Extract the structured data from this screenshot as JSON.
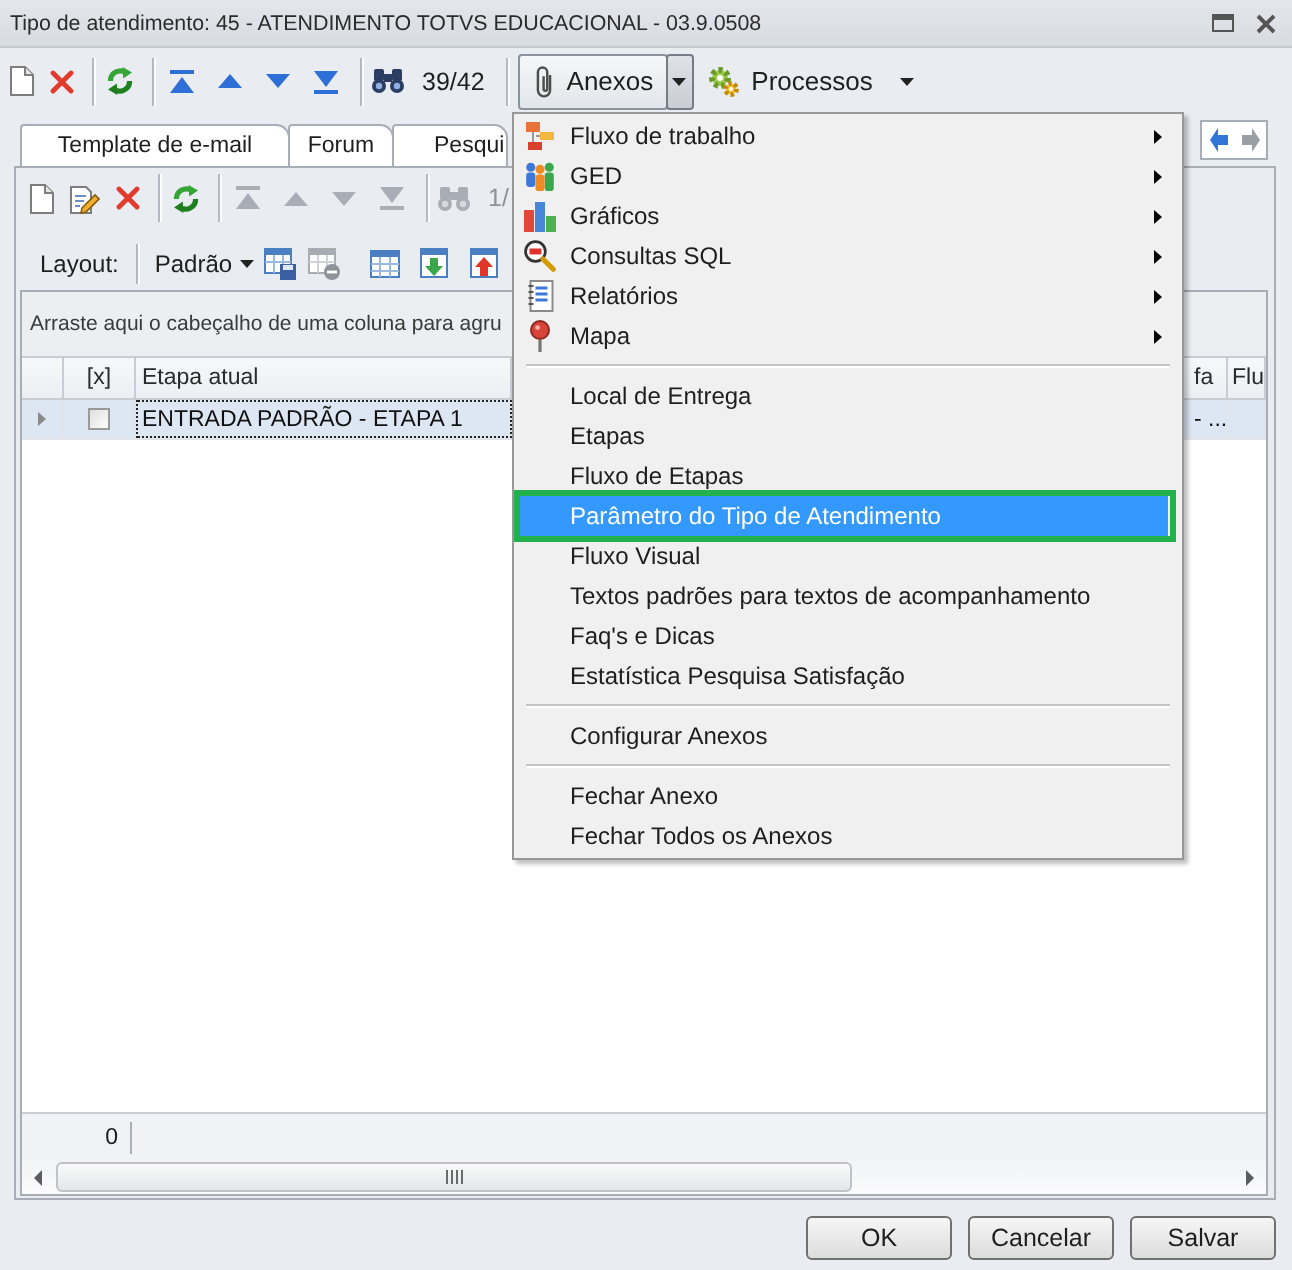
{
  "window": {
    "title": "Tipo de atendimento: 45 - ATENDIMENTO TOTVS EDUCACIONAL - 03.9.0508"
  },
  "toolbar": {
    "navigation_enabled": true,
    "search_enabled": true,
    "record_counter": "39/42",
    "attachments": {
      "label": "Anexos",
      "expanded": true
    },
    "processes": {
      "label": "Processos"
    }
  },
  "tabs": [
    {
      "label": "Template de e-mail"
    },
    {
      "label": "Forum"
    },
    {
      "label": "Pesqui"
    }
  ],
  "grid_toolbar": {
    "navigation_enabled": false,
    "search_enabled": false,
    "record_counter": "1/"
  },
  "layout_bar": {
    "label": "Layout:",
    "layout": "Padrão",
    "remove_enabled": false
  },
  "grid": {
    "group_panel": "Arraste aqui o cabeçalho de uma coluna para agru",
    "checkbox_column": "[x]",
    "columns": [
      "Etapa atual",
      "fa",
      "Flu"
    ],
    "rows": [
      {
        "selected": true,
        "checked": false,
        "cells": [
          "ENTRADA PADRÃO - ETAPA 1",
          "- ..."
        ]
      }
    ],
    "footer": "0"
  },
  "anexos_menu": {
    "sections": [
      {
        "items": [
          {
            "kind": "submenu",
            "label": "Fluxo de trabalho",
            "selected": false,
            "annotated": false
          },
          {
            "kind": "submenu",
            "label": "GED",
            "selected": false,
            "annotated": false
          },
          {
            "kind": "submenu",
            "label": "Gráficos",
            "selected": false,
            "annotated": false
          },
          {
            "kind": "submenu",
            "label": "Consultas SQL",
            "selected": false,
            "annotated": false
          },
          {
            "kind": "submenu",
            "label": "Relatórios",
            "selected": false,
            "annotated": false
          },
          {
            "kind": "submenu",
            "label": "Mapa",
            "selected": false,
            "annotated": false
          }
        ]
      },
      {
        "items": [
          {
            "kind": "command",
            "label": "Local de Entrega",
            "selected": false,
            "annotated": false
          },
          {
            "kind": "command",
            "label": "Etapas",
            "selected": false,
            "annotated": false
          },
          {
            "kind": "command",
            "label": "Fluxo de Etapas",
            "selected": false,
            "annotated": false
          },
          {
            "kind": "command",
            "label": "Parâmetro do Tipo de Atendimento",
            "selected": true,
            "annotated": true
          },
          {
            "kind": "command",
            "label": "Fluxo Visual",
            "selected": false,
            "annotated": false
          },
          {
            "kind": "command",
            "label": "Textos padrões para textos de acompanhamento",
            "selected": false,
            "annotated": false
          },
          {
            "kind": "command",
            "label": "Faq's e Dicas",
            "selected": false,
            "annotated": false
          },
          {
            "kind": "command",
            "label": "Estatística Pesquisa Satisfação",
            "selected": false,
            "annotated": false
          }
        ]
      },
      {
        "items": [
          {
            "kind": "command",
            "label": "Configurar Anexos",
            "selected": false,
            "annotated": false
          }
        ]
      },
      {
        "items": [
          {
            "kind": "command",
            "label": "Fechar Anexo",
            "selected": false,
            "annotated": false
          },
          {
            "kind": "command",
            "label": "Fechar Todos os Anexos",
            "selected": false,
            "annotated": false
          }
        ]
      }
    ]
  },
  "dialog_buttons": [
    {
      "label": "OK"
    },
    {
      "label": "Cancelar"
    },
    {
      "label": "Salvar"
    }
  ]
}
